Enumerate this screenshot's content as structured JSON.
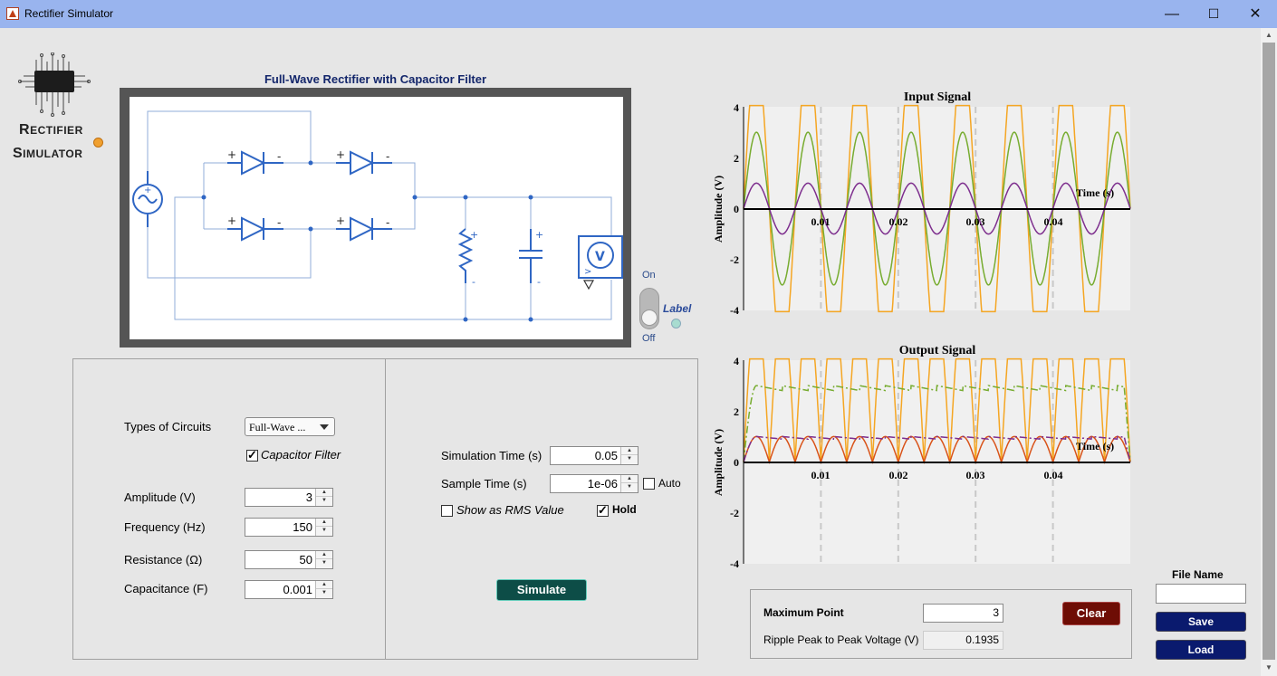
{
  "window": {
    "title": "Rectifier Simulator",
    "min": "—",
    "max": "☐",
    "close": "✕"
  },
  "logo": {
    "line1_big": "R",
    "line1_rest": "ECTIFIER",
    "line2_big": "S",
    "line2_rest": "IMULATOR"
  },
  "schematic": {
    "title": "Full-Wave Rectifier with Capacitor Filter"
  },
  "label_toggle": {
    "on": "On",
    "off": "Off",
    "label": "Label",
    "state": "off"
  },
  "params": {
    "types_label": "Types of Circuits",
    "circuit_type": "Full-Wave ...",
    "capacitor_filter_label": "Capacitor Filter",
    "capacitor_filter_checked": true,
    "amplitude_label": "Amplitude (V)",
    "amplitude": "3",
    "frequency_label": "Frequency (Hz)",
    "frequency": "150",
    "resistance_label": "Resistance (Ω)",
    "resistance": "50",
    "capacitance_label": "Capacitance (F)",
    "capacitance": "0.001"
  },
  "sim": {
    "sim_time_label": "Simulation Time (s)",
    "sim_time": "0.05",
    "sample_time_label": "Sample Time (s)",
    "sample_time": "1e-06",
    "auto_label": "Auto",
    "auto_checked": false,
    "rms_label": "Show as RMS Value",
    "rms_checked": false,
    "hold_label": "Hold",
    "hold_checked": true,
    "simulate_label": "Simulate"
  },
  "results": {
    "max_point_label": "Maximum Point",
    "max_point": "3",
    "ripple_label": "Ripple Peak to Peak Voltage (V)",
    "ripple": "0.1935",
    "clear_label": "Clear"
  },
  "file": {
    "name_label": "File Name",
    "name_value": "",
    "save_label": "Save",
    "load_label": "Load"
  },
  "colors": {
    "title_bar": "#99b4ee",
    "simulate_btn": "#0d4d47",
    "clear_btn": "#6e0d05",
    "save_load_btn": "#0a1a6e",
    "orange": "#f5a623",
    "green": "#77ac30",
    "purple": "#7e2f8e",
    "red": "#d95319",
    "schematic_blue": "#2f66c4"
  },
  "chart_data": [
    {
      "type": "line",
      "title": "Input Signal",
      "xlabel": "Time (s)",
      "ylabel": "Amplitude (V)",
      "xlim": [
        0,
        0.05
      ],
      "ylim": [
        -4,
        4
      ],
      "xticks": [
        "0.01",
        "0.02",
        "0.03",
        "0.04"
      ],
      "yticks": [
        "4",
        "2",
        "0",
        "-2",
        "-4"
      ],
      "frequency_hz": 150,
      "grid": "vertical dashed",
      "series": [
        {
          "amplitude": 6,
          "color": "#f5a623"
        },
        {
          "amplitude": 3,
          "color": "#77ac30"
        },
        {
          "amplitude": 1,
          "color": "#7e2f8e"
        }
      ]
    },
    {
      "type": "line",
      "title": "Output Signal",
      "xlabel": "Time (s)",
      "ylabel": "Amplitude (V)",
      "xlim": [
        0,
        0.05
      ],
      "ylim": [
        -4,
        4
      ],
      "xticks": [
        "0.01",
        "0.02",
        "0.03",
        "0.04"
      ],
      "yticks": [
        "4",
        "2",
        "0",
        "-2",
        "-4"
      ],
      "frequency_hz": 150,
      "grid": "vertical dashed",
      "series": [
        {
          "kind": "rectified",
          "amplitude": 6,
          "color": "#f5a623"
        },
        {
          "kind": "filtered",
          "level": 3,
          "ripple": 0.1935,
          "color": "#77ac30",
          "dash": "dash-dot"
        },
        {
          "kind": "rectified",
          "amplitude": 1,
          "color": "#d95319"
        },
        {
          "kind": "filtered",
          "level": 1,
          "ripple": 0.1,
          "color": "#7e2f8e",
          "dash": "dash-dot"
        }
      ]
    }
  ]
}
